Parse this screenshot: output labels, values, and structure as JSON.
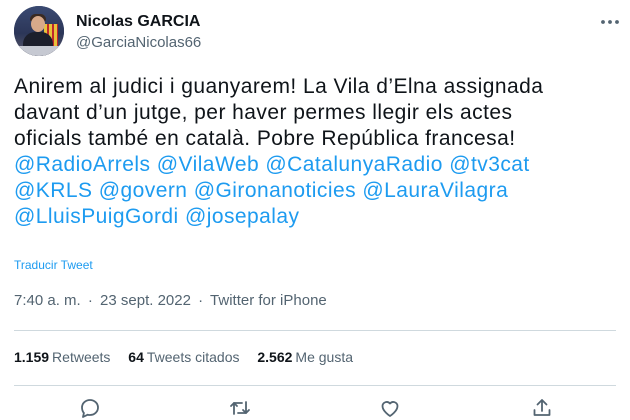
{
  "author": {
    "name": "Nicolas GARCIA",
    "handle": "@GarciaNicolas66"
  },
  "tweet": {
    "text_lines": [
      "Anirem al judici i guanyarem! La Vila d’Elna assignada",
      "davant d’un jutge, per haver permes llegir els actes",
      "oficials també en català. Pobre República francesa!"
    ],
    "mention_lines": [
      [
        "@RadioArrels",
        "@VilaWeb",
        "@CatalunyaRadio",
        "@tv3cat"
      ],
      [
        "@KRLS",
        "@govern",
        "@Gironanoticies",
        "@LauraVilagra"
      ],
      [
        "@LluisPuigGordi",
        "@josepalay"
      ]
    ],
    "translate_label": "Traducir Tweet",
    "time": "7:40 a. m.",
    "separator": "·",
    "date": "23 sept. 2022",
    "source": "Twitter for iPhone"
  },
  "stats": {
    "retweets": {
      "count": "1.159",
      "label": "Retweets"
    },
    "quotes": {
      "count": "64",
      "label": "Tweets citados"
    },
    "likes": {
      "count": "2.562",
      "label": "Me gusta"
    }
  },
  "icons": {
    "more": "more-icon",
    "reply": "reply-icon",
    "retweet": "retweet-icon",
    "like": "like-icon",
    "share": "share-icon"
  },
  "colors": {
    "link": "#1d9bf0",
    "secondary_text": "#536471",
    "primary_text": "#0f1419",
    "divider": "#cfd9de"
  }
}
